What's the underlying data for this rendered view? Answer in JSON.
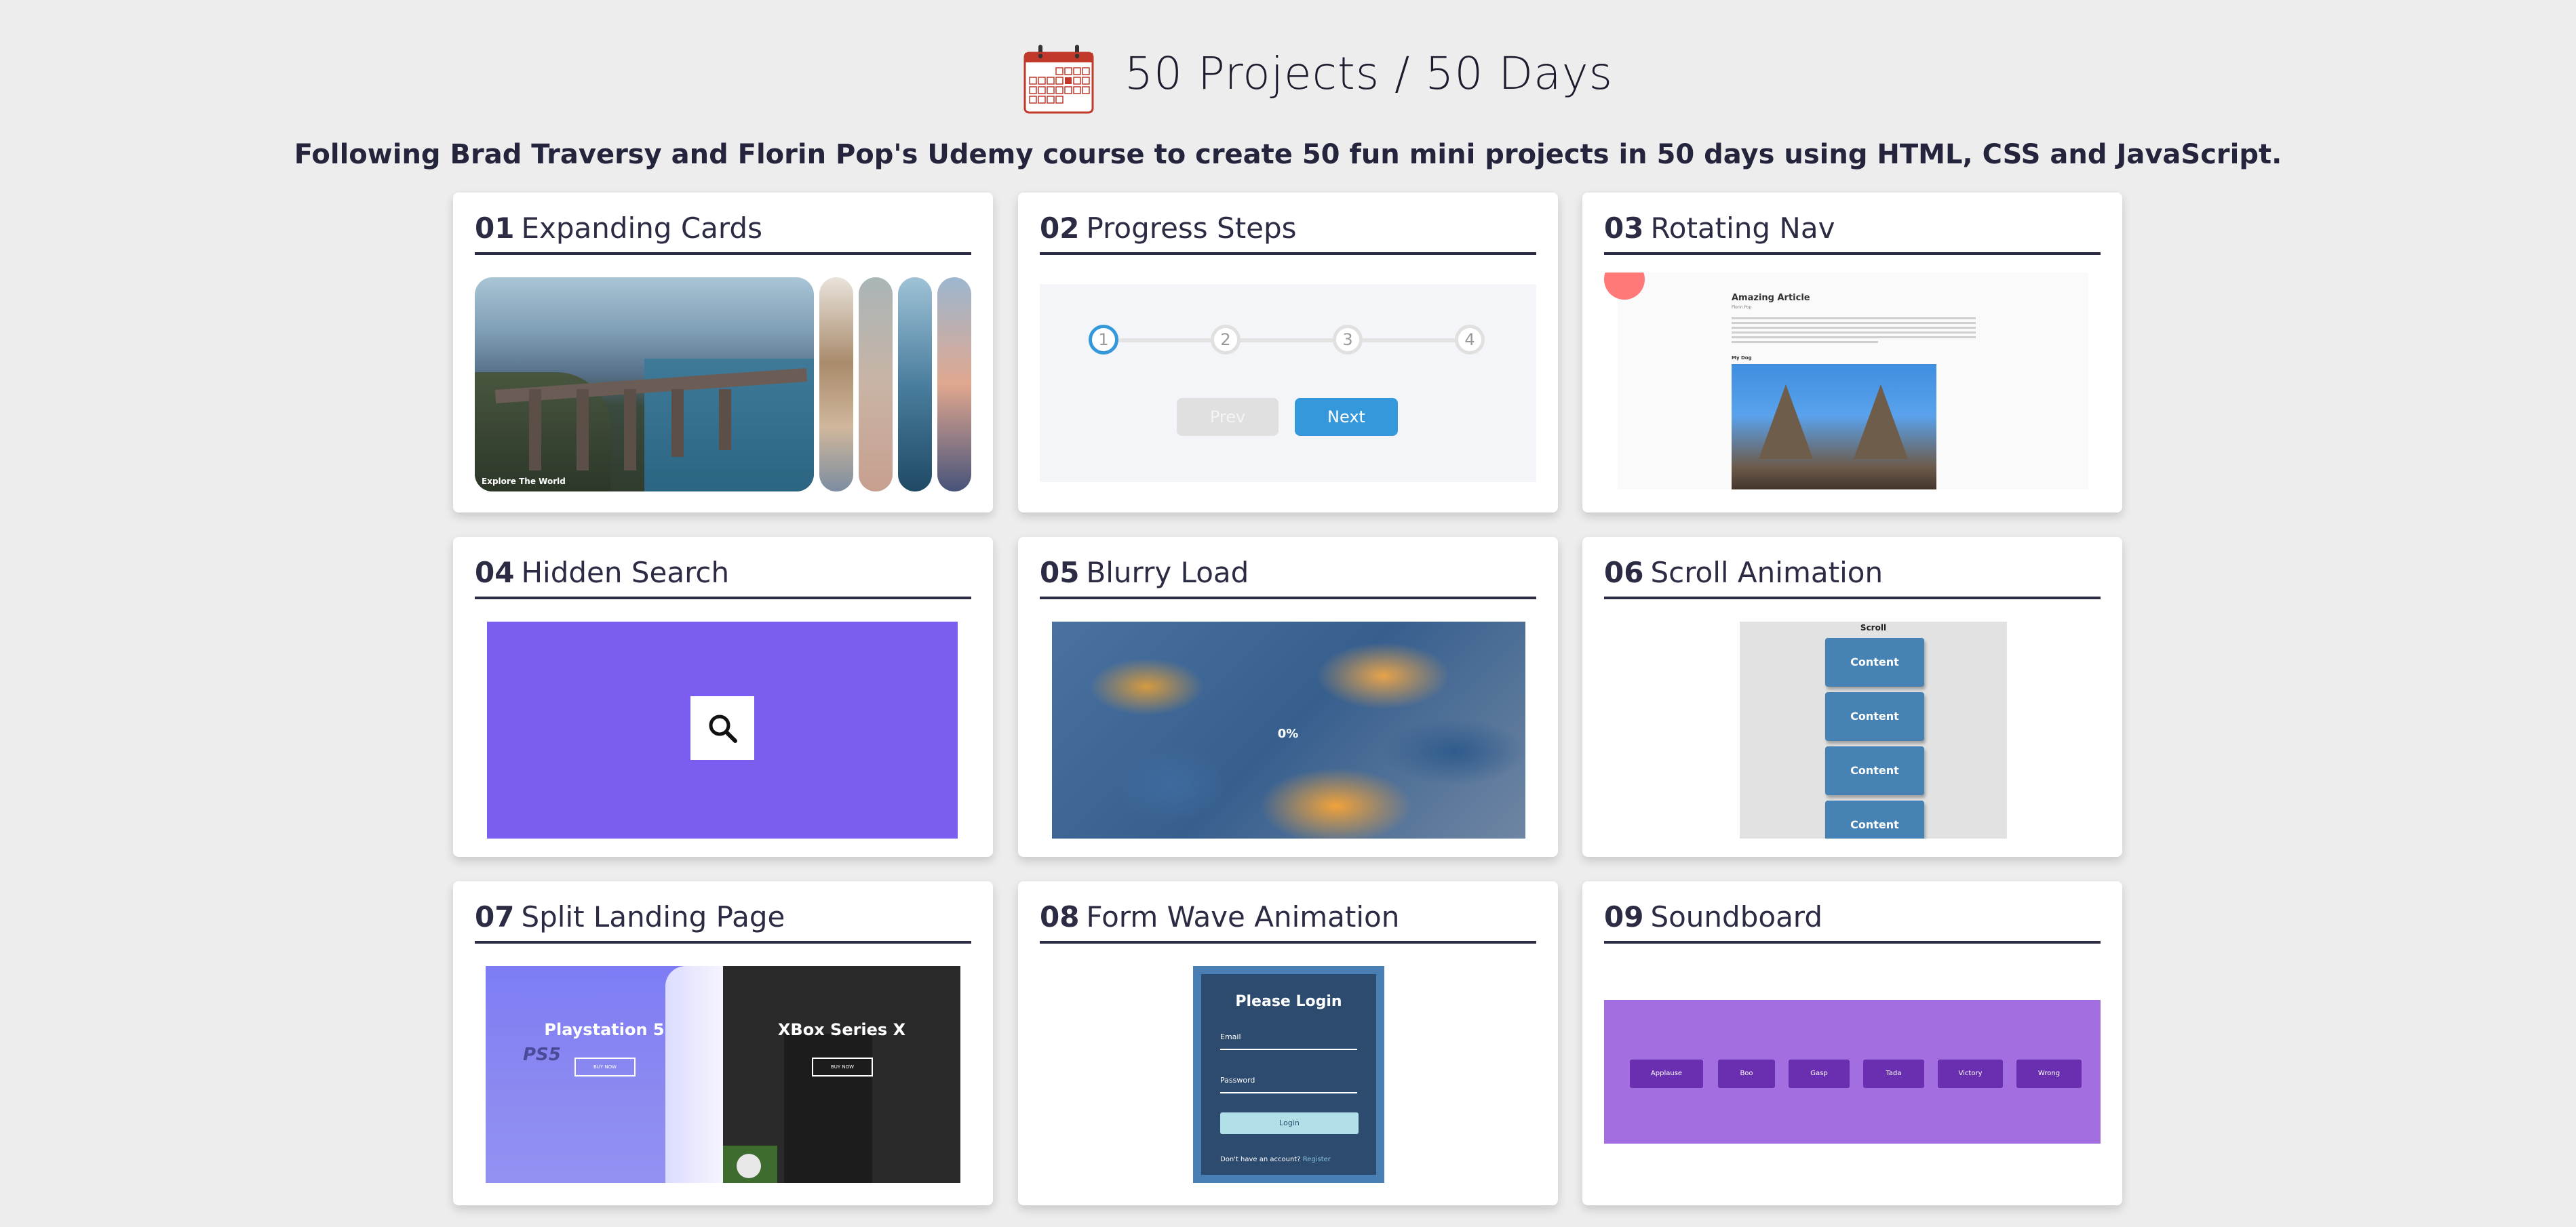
{
  "header": {
    "title": "50 Projects / 50 Days",
    "subtitle": "Following Brad Traversy and Florin Pop's Udemy course to create 50 fun mini projects in 50 days using HTML, CSS and JavaScript."
  },
  "projects": [
    {
      "num": "01",
      "name": "Expanding Cards",
      "preview": {
        "caption": "Explore The World"
      }
    },
    {
      "num": "02",
      "name": "Progress Steps",
      "preview": {
        "steps": [
          "1",
          "2",
          "3",
          "4"
        ],
        "prev": "Prev",
        "next": "Next"
      }
    },
    {
      "num": "03",
      "name": "Rotating Nav",
      "preview": {
        "article_title": "Amazing Article",
        "article_sub": "Florin Pop",
        "section_heading": "My Dog"
      }
    },
    {
      "num": "04",
      "name": "Hidden Search",
      "preview": {
        "icon": "search-icon"
      }
    },
    {
      "num": "05",
      "name": "Blurry Load",
      "preview": {
        "loading": "0%"
      }
    },
    {
      "num": "06",
      "name": "Scroll Animation",
      "preview": {
        "heading": "Scroll",
        "boxes": [
          "Content",
          "Content",
          "Content",
          "Content"
        ]
      }
    },
    {
      "num": "07",
      "name": "Split Landing Page",
      "preview": {
        "left_title": "Playstation 5",
        "right_title": "XBox Series X",
        "button": "BUY NOW",
        "left_logo": "PS5"
      }
    },
    {
      "num": "08",
      "name": "Form Wave Animation",
      "preview": {
        "heading": "Please Login",
        "email": "Email",
        "password": "Password",
        "button": "Login",
        "footer": "Don't have an account?",
        "footer_link": "Register"
      }
    },
    {
      "num": "09",
      "name": "Soundboard",
      "preview": {
        "buttons": [
          "Applause",
          "Boo",
          "Gasp",
          "Tada",
          "Victory",
          "Wrong"
        ]
      }
    }
  ],
  "colors": {
    "background": "#ededed",
    "card": "#ffffff",
    "title_text": "#2b2b44",
    "progress_accent": "#3498db",
    "search_bg": "#7b5df0",
    "scroll_box": "#4682b4",
    "soundboard_bg": "#a26ee0"
  }
}
